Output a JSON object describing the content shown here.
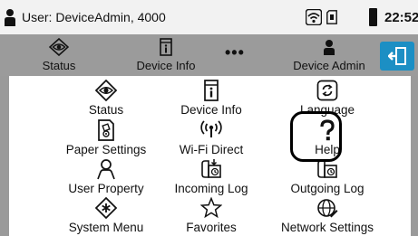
{
  "statusbar": {
    "user_text": "User: DeviceAdmin, 4000",
    "time": "22:52"
  },
  "tabs": [
    {
      "label": "Status",
      "icon": "status-eye-icon"
    },
    {
      "label": "Device Info",
      "icon": "device-info-icon"
    },
    {
      "label": "•••",
      "icon": "more-icon"
    },
    {
      "label": "Device Admin",
      "icon": "user-icon"
    }
  ],
  "exit_button": {
    "icon": "exit-door-icon"
  },
  "menu": {
    "items": [
      {
        "label": "Status",
        "icon": "status-eye-icon"
      },
      {
        "label": "Device Info",
        "icon": "device-info-icon"
      },
      {
        "label": "Language",
        "icon": "language-icon"
      },
      {
        "label": "Paper Settings",
        "icon": "paper-settings-icon"
      },
      {
        "label": "Wi-Fi Direct",
        "icon": "wifi-direct-icon"
      },
      {
        "label": "Help",
        "icon": "help-icon"
      },
      {
        "label": "User Property",
        "icon": "user-property-icon"
      },
      {
        "label": "Incoming Log",
        "icon": "incoming-log-icon"
      },
      {
        "label": "Outgoing Log",
        "icon": "outgoing-log-icon"
      },
      {
        "label": "System Menu",
        "icon": "system-menu-icon"
      },
      {
        "label": "Favorites",
        "icon": "favorites-star-icon"
      },
      {
        "label": "Network Settings",
        "icon": "network-settings-icon"
      }
    ]
  },
  "colors": {
    "accent": "#1c8fc4",
    "tabbar_bg": "#9b9b9b",
    "statusbar_bg": "#f2f2f2"
  }
}
